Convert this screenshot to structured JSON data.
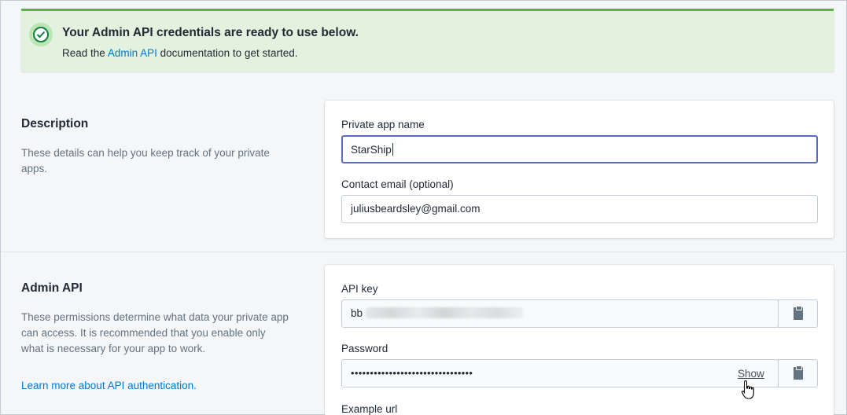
{
  "banner": {
    "title": "Your Admin API credentials are ready to use below.",
    "text_before": "Read the",
    "link": "Admin API",
    "text_after": "documentation to get started.",
    "icon": "checkmark-circle-icon"
  },
  "description": {
    "title": "Description",
    "text": "These details can help you keep track of your private apps.",
    "app_name_label": "Private app name",
    "app_name_value": "StarShip",
    "email_label": "Contact email (optional)",
    "email_value": "juliusbeardsley@gmail.com"
  },
  "admin_api": {
    "title": "Admin API",
    "text": "These permissions determine what data your private app can access. It is recommended that you enable only what is necessary for your app to work.",
    "learn_link": "Learn more about API authentication.",
    "api_key_label": "API key",
    "api_key_prefix": "bb",
    "password_label": "Password",
    "password_masked": "••••••••••••••••••••••••••••••••",
    "show_label": "Show",
    "example_url_label": "Example url"
  },
  "colors": {
    "accent": "#007ace",
    "success": "#50b83c",
    "focus": "#5c6ac4"
  }
}
